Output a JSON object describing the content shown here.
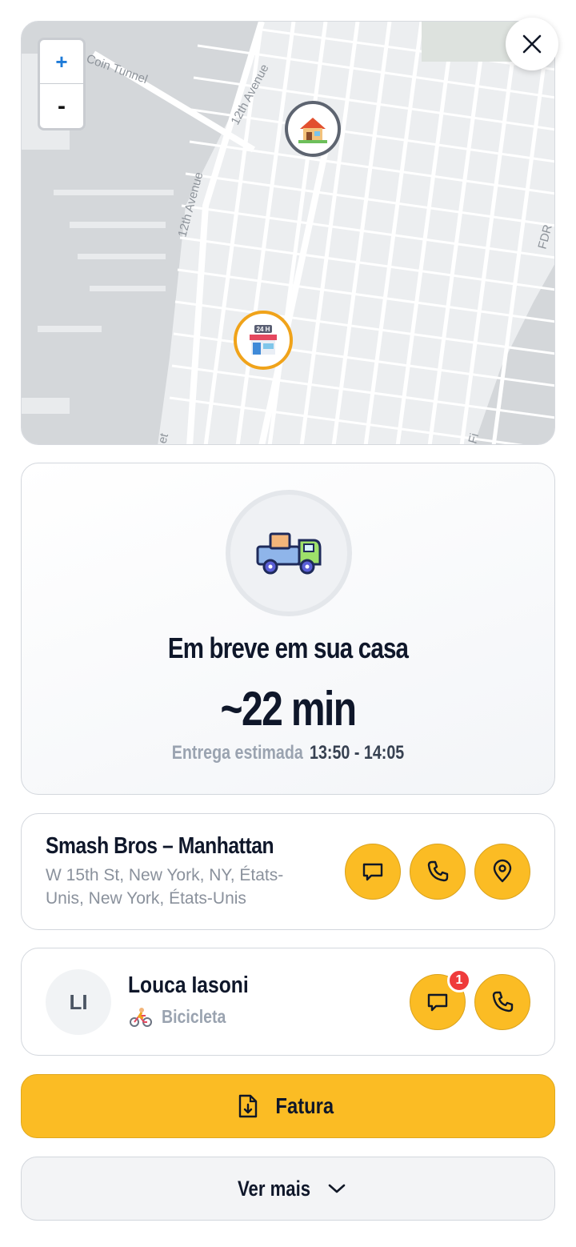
{
  "map": {
    "zoom_in_label": "+",
    "zoom_out_label": "-",
    "street_labels": [
      "Coin Tunnel",
      "12th Avenue",
      "12th Avenue",
      "FDR",
      "Fi",
      "et"
    ]
  },
  "eta": {
    "title": "Em breve em sua casa",
    "time": "~22 min",
    "estimate_label": "Entrega estimada",
    "estimate_window": "13:50 - 14:05"
  },
  "restaurant": {
    "name": "Smash Bros – Manhattan",
    "address": "W 15th St, New York, NY, États-Unis, New York, États-Unis"
  },
  "courier": {
    "initials": "LI",
    "name": "Louca Iasoni",
    "vehicle": "Bicicleta",
    "unread_count": "1"
  },
  "actions": {
    "invoice_label": "Fatura",
    "more_label": "Ver mais"
  },
  "colors": {
    "accent": "#fbbc24",
    "badge": "#ef3b3b",
    "store_marker": "#f0a31a",
    "home_marker": "#5d6470"
  }
}
